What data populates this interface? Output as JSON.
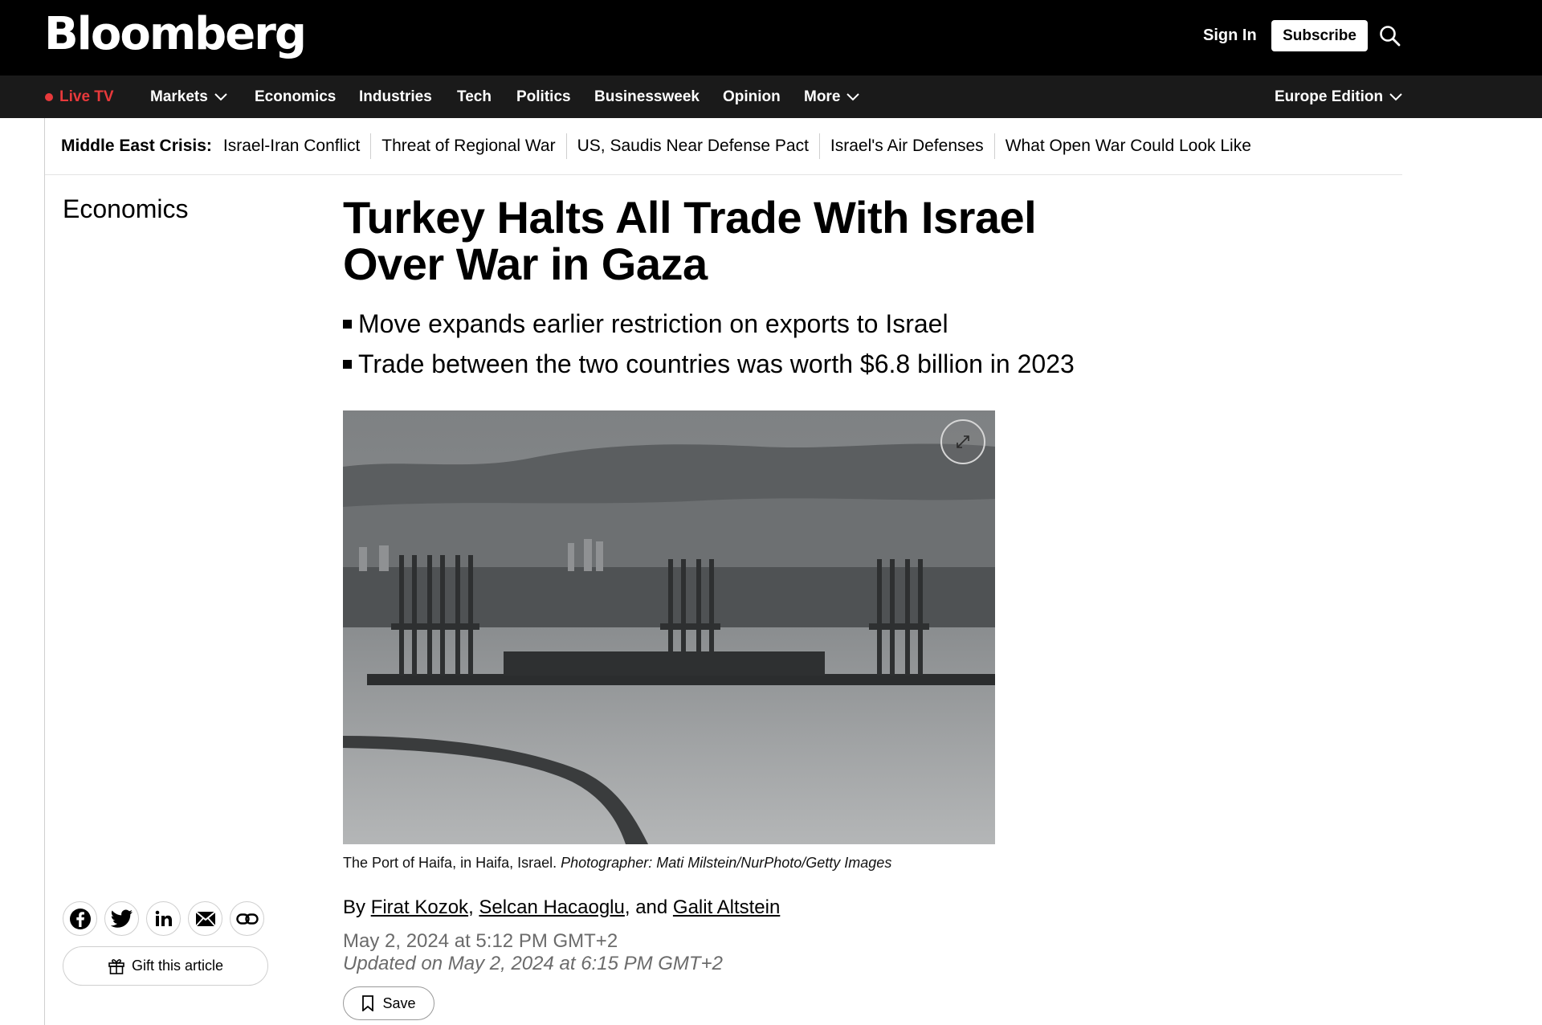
{
  "header": {
    "logo": "Bloomberg",
    "sign_in": "Sign In",
    "subscribe": "Subscribe",
    "search_icon": "search-icon"
  },
  "nav": {
    "live_tv": "Live TV",
    "items": [
      "Markets",
      "Economics",
      "Industries",
      "Tech",
      "Politics",
      "Businessweek",
      "Opinion",
      "More"
    ],
    "edition": "Europe Edition"
  },
  "crisis": {
    "label": "Middle East Crisis:",
    "links": [
      "Israel-Iran Conflict",
      "Threat of Regional War",
      "US, Saudis Near Defense Pact",
      "Israel's Air Defenses",
      "What Open War Could Look Like"
    ]
  },
  "article": {
    "section": "Economics",
    "headline": "Turkey Halts All Trade With Israel Over War in Gaza",
    "bullets": [
      "Move expands earlier restriction on exports to Israel",
      "Trade between the two countries was worth $6.8 billion in 2023"
    ],
    "caption_text": "The Port of Haifa, in Haifa, Israel. ",
    "caption_credit": "Photographer: Mati Milstein/NurPhoto/Getty Images",
    "byline_prefix": "By ",
    "authors": [
      "Firat Kozok",
      "Selcan Hacaoglu",
      "Galit Altstein"
    ],
    "byline_sep1": ", ",
    "byline_sep2": ", and ",
    "published": "May 2, 2024 at 5:12 PM GMT+2",
    "updated": "Updated on May 2, 2024 at 6:15 PM GMT+2",
    "save_label": "Save"
  },
  "share": {
    "gift_label": "Gift this article",
    "icons": [
      "facebook-icon",
      "twitter-icon",
      "linkedin-icon",
      "email-icon",
      "link-icon"
    ]
  },
  "colors": {
    "live_red": "#e8393b",
    "topbar": "#000000",
    "navbar": "#1a1a1a"
  }
}
